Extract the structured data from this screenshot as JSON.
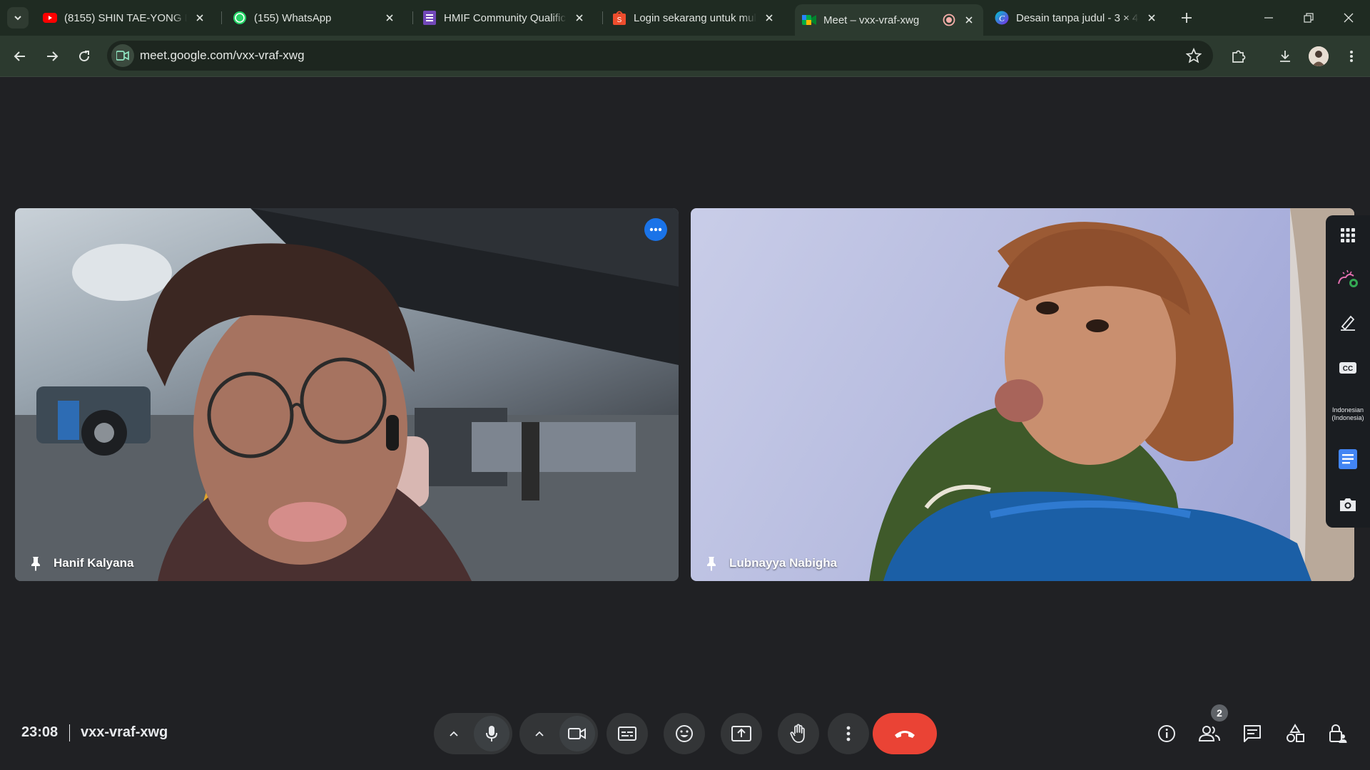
{
  "browser": {
    "tabs": [
      {
        "title": "(8155) SHIN TAE-YONG BE",
        "favicon": "youtube-icon",
        "active": false
      },
      {
        "title": "(155) WhatsApp",
        "favicon": "whatsapp-icon",
        "active": false
      },
      {
        "title": "HMIF Community Qualifica",
        "favicon": "forms-icon",
        "active": false
      },
      {
        "title": "Login sekarang untuk mula",
        "favicon": "shop-icon",
        "active": false
      },
      {
        "title": "Meet – vxx-vraf-xwg",
        "favicon": "meet-icon",
        "active": true
      },
      {
        "title": "Desain tanpa judul - 3 × 4c",
        "favicon": "canva-icon",
        "active": false
      }
    ],
    "url": "meet.google.com/vxx-vraf-xwg"
  },
  "meet": {
    "participants": [
      {
        "name": "Hanif Kalyana"
      },
      {
        "name": "Lubnayya Nabigha"
      }
    ],
    "side_panel": {
      "caption_language": "Indonesian (Indonesia)"
    },
    "bottom_bar": {
      "time": "23:08",
      "meeting_code": "vxx-vraf-xwg",
      "people_count": "2"
    }
  },
  "colors": {
    "end_call": "#ea4335",
    "accent_blue": "#1a73e8",
    "background": "#202124"
  }
}
